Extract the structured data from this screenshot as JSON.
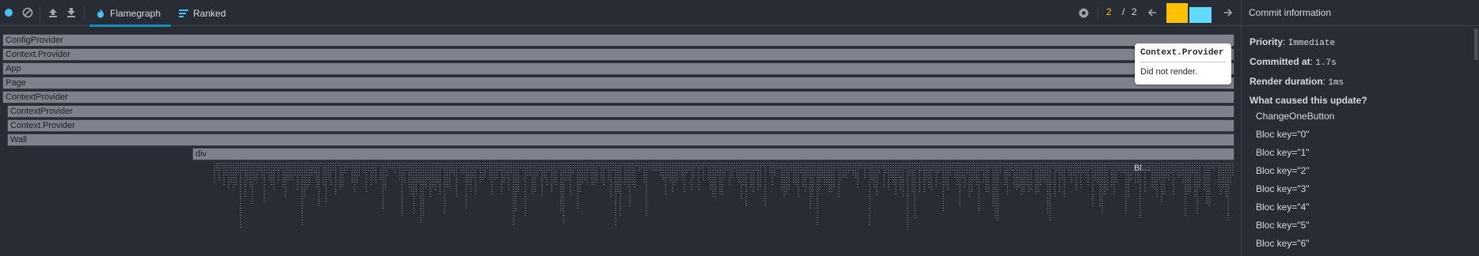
{
  "toolbar": {
    "tabs": [
      {
        "label": "Flamegraph",
        "icon": "flame-icon",
        "active": true
      },
      {
        "label": "Ranked",
        "icon": "ranked-icon",
        "active": false
      }
    ],
    "commit_current": "2",
    "commit_sep": "/",
    "commit_total": "2",
    "colors": {
      "record": "#4ac1f6",
      "commit_selected": "#ffc107",
      "commit_other": "#61dafb",
      "tab_underline": "#178fb9"
    }
  },
  "flamegraph": {
    "frames": [
      {
        "label": "ConfigProvider"
      },
      {
        "label": "Context.Provider"
      },
      {
        "label": "App"
      },
      {
        "label": "Page"
      },
      {
        "label": "ContextProvider"
      },
      {
        "label": "ContextProvider"
      },
      {
        "label": "Context.Provider"
      },
      {
        "label": "Wall"
      },
      {
        "label": "div"
      }
    ],
    "overflow_label": "Bl…"
  },
  "tooltip": {
    "title": "Context.Provider",
    "body": "Did not render."
  },
  "sidebar": {
    "title": "Commit information",
    "priority_label": "Priority",
    "priority_value": "Immediate",
    "committed_label": "Committed at",
    "committed_value": "1.7s",
    "duration_label": "Render duration",
    "duration_value": "1ms",
    "causes_label": "What caused this update?",
    "causes": [
      "ChangeOneButton",
      "Bloc key=\"0\"",
      "Bloc key=\"1\"",
      "Bloc key=\"2\"",
      "Bloc key=\"3\"",
      "Bloc key=\"4\"",
      "Bloc key=\"5\"",
      "Bloc key=\"6\""
    ]
  }
}
